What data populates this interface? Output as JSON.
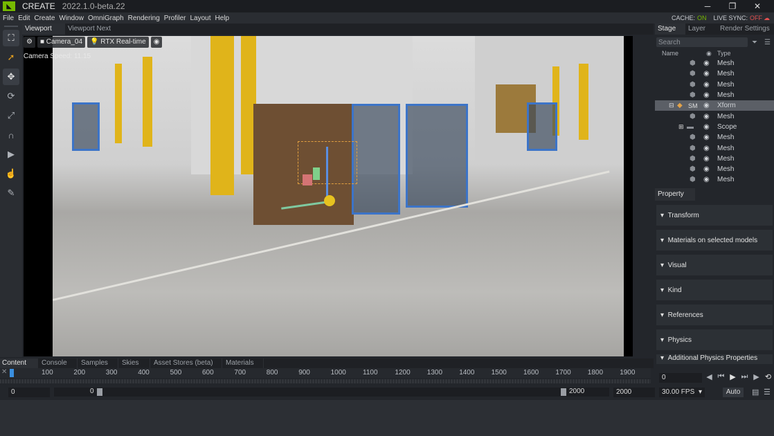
{
  "title_bar": {
    "app_name": "CREATE",
    "version": "2022.1.0-beta.22",
    "minimize": "─",
    "restore": "❐",
    "close": "✕"
  },
  "menu": {
    "items": [
      "File",
      "Edit",
      "Create",
      "Window",
      "OmniGraph",
      "Rendering",
      "Profiler",
      "Layout",
      "Help"
    ],
    "cache_label": "CACHE:",
    "cache_value": "ON",
    "live_sync_label": "LIVE SYNC:",
    "live_sync_value": "OFF"
  },
  "viewport": {
    "tabs": [
      "Viewport",
      "Viewport Next"
    ],
    "camera": "Camera_04",
    "renderer": "RTX Real-time",
    "camera_speed": "Camera Speed: 11.15"
  },
  "stage": {
    "tabs": [
      "Stage",
      "Layer",
      "Render Settings"
    ],
    "search_placeholder": "Search",
    "col_name": "Name",
    "col_type": "Type",
    "rows": [
      {
        "name": "",
        "type": "Mesh",
        "expander": "",
        "selected": false
      },
      {
        "name": "",
        "type": "Mesh",
        "expander": "",
        "selected": false
      },
      {
        "name": "",
        "type": "Mesh",
        "expander": "",
        "selected": false
      },
      {
        "name": "",
        "type": "Mesh",
        "expander": "",
        "selected": false
      },
      {
        "name": "SM",
        "type": "Xform",
        "expander": "⊟",
        "selected": true
      },
      {
        "name": "",
        "type": "Mesh",
        "expander": "",
        "selected": false
      },
      {
        "name": "",
        "type": "Scope",
        "expander": "⊞",
        "selected": false
      },
      {
        "name": "",
        "type": "Mesh",
        "expander": "",
        "selected": false
      },
      {
        "name": "",
        "type": "Mesh",
        "expander": "",
        "selected": false
      },
      {
        "name": "",
        "type": "Mesh",
        "expander": "",
        "selected": false
      },
      {
        "name": "",
        "type": "Mesh",
        "expander": "",
        "selected": false
      },
      {
        "name": "",
        "type": "Mesh",
        "expander": "",
        "selected": false
      }
    ]
  },
  "property": {
    "tab": "Property",
    "sections": [
      "Transform",
      "Materials on selected models",
      "Visual",
      "Kind",
      "References",
      "Physics",
      "Additional Physics Properties"
    ]
  },
  "bottom": {
    "tabs": [
      "Content",
      "Console",
      "Samples",
      "Skies",
      "Asset Stores (beta)",
      "Materials"
    ],
    "ticks": [
      "100",
      "200",
      "300",
      "400",
      "500",
      "600",
      "700",
      "800",
      "900",
      "1000",
      "1100",
      "1200",
      "1300",
      "1400",
      "1500",
      "1600",
      "1700",
      "1800",
      "1900"
    ],
    "start_field": "0",
    "range_start": "0",
    "range_end": "2000",
    "end_field": "2000",
    "current_frame": "0",
    "fps": "30.00 FPS",
    "auto": "Auto"
  }
}
